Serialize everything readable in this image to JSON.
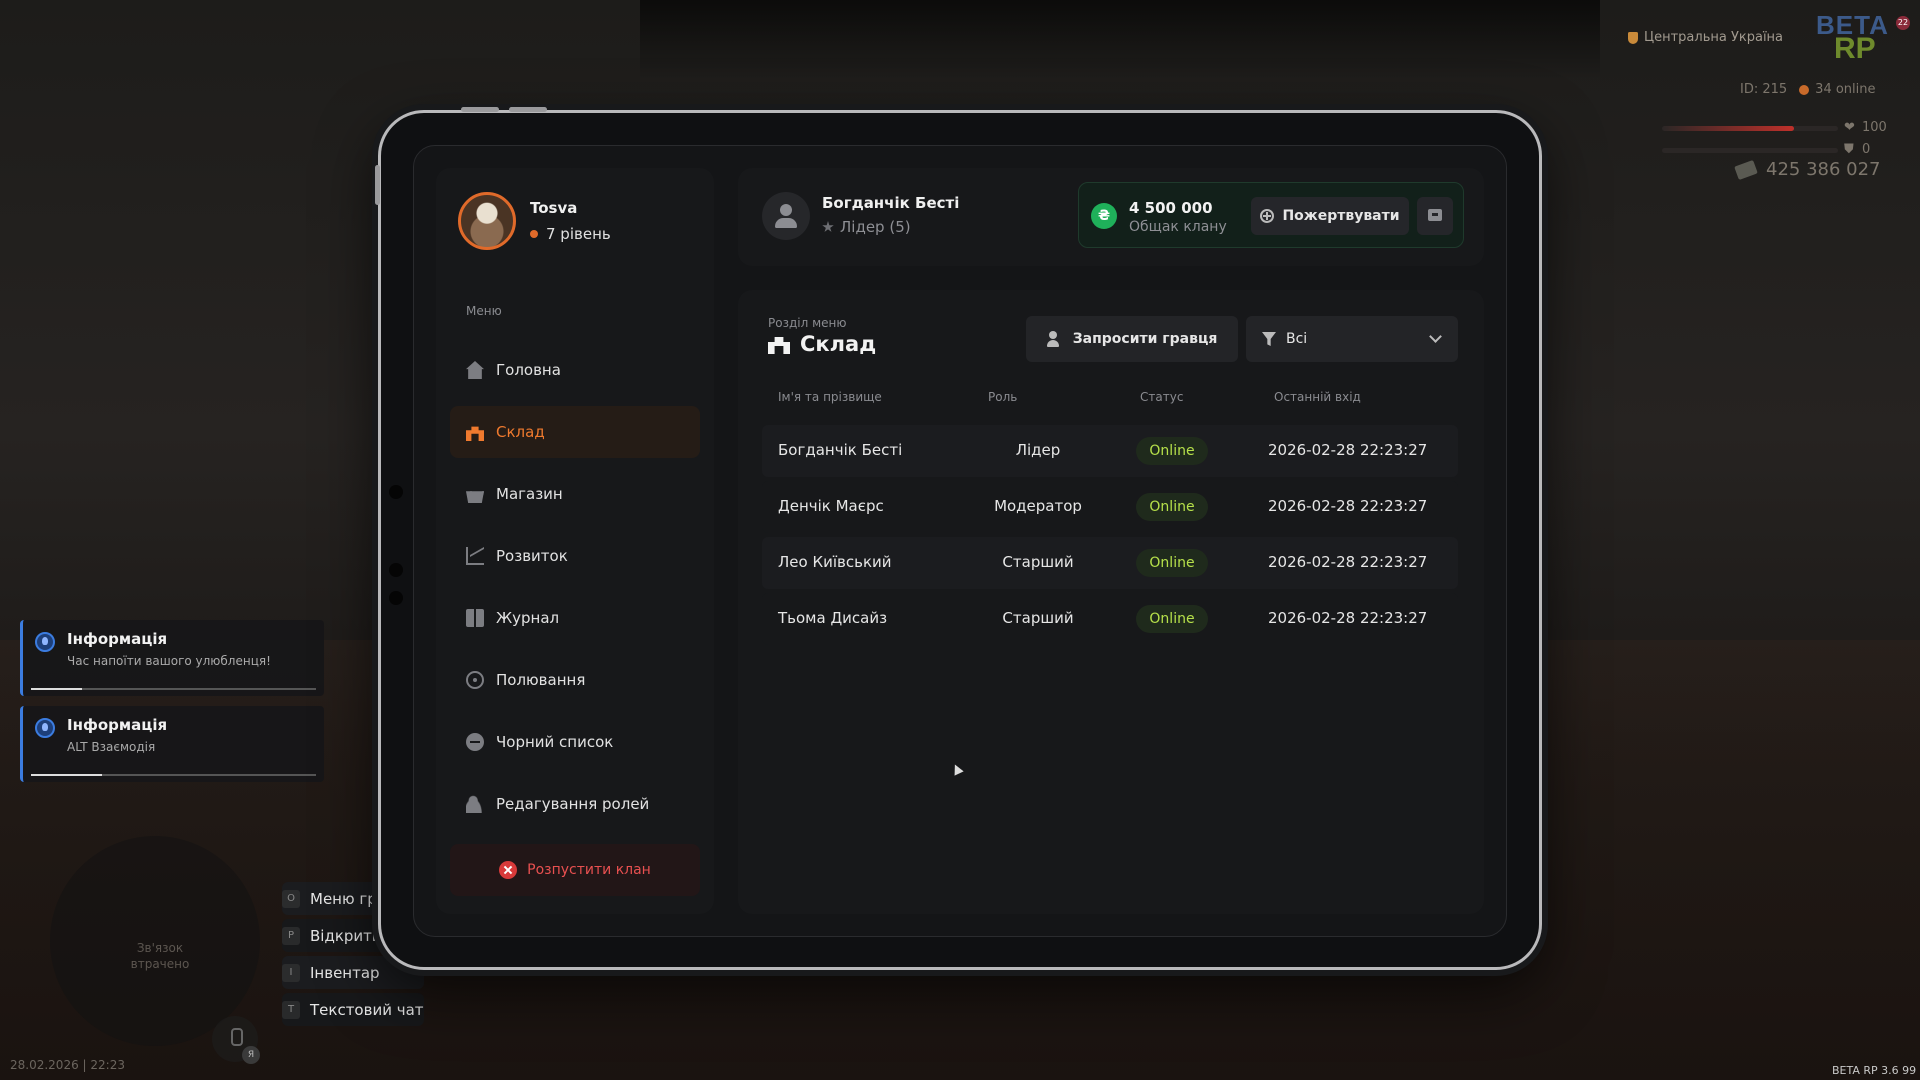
{
  "hud": {
    "region": "Центральна Україна",
    "logo_top": "BETA",
    "logo_bottom": "RP",
    "logo_badge": "22",
    "player_id": "ID: 215",
    "online": "34 online",
    "health_value": "100",
    "health_fraction": 0.75,
    "armor_value": "0",
    "armor_fraction": 0.0,
    "money": "425 386 027",
    "datetime": "28.02.2026 | 22:23",
    "version": "BETA RP 3.6",
    "version_suffix": "99",
    "radar_text": "Зв'язок втрачено",
    "mic_badge": "Я",
    "hotkeys": [
      {
        "key": "O",
        "label": "Меню гра"
      },
      {
        "key": "P",
        "label": "Відкрити"
      },
      {
        "key": "I",
        "label": "Інвентар"
      },
      {
        "key": "T",
        "label": "Текстовий чат"
      }
    ],
    "colors": {
      "health": "#c0302a",
      "accent": "#f07a2e",
      "online_status": "#b6e04a",
      "bank": "#1fb05a"
    }
  },
  "notifications": [
    {
      "title": "Інформація",
      "message": "Час напоїти вашого улюбленця!",
      "progress": 0.18
    },
    {
      "title": "Інформація",
      "message": "ALT Взаємодія",
      "progress": 0.25
    }
  ],
  "sidebar": {
    "player_name": "Tosva",
    "player_level": "7 рівень",
    "menu_caption": "Меню",
    "items": [
      {
        "label": "Головна",
        "icon": "home-icon",
        "active": false
      },
      {
        "label": "Склад",
        "icon": "warehouse-icon",
        "active": true
      },
      {
        "label": "Магазин",
        "icon": "shop-icon",
        "active": false
      },
      {
        "label": "Розвиток",
        "icon": "growth-chart-icon",
        "active": false
      },
      {
        "label": "Журнал",
        "icon": "journal-icon",
        "active": false
      },
      {
        "label": "Полювання",
        "icon": "crosshair-icon",
        "active": false
      },
      {
        "label": "Чорний список",
        "icon": "blacklist-icon",
        "active": false
      },
      {
        "label": "Редагування ролей",
        "icon": "user-edit-icon",
        "active": false
      }
    ],
    "dissolve_label": "Розпустити клан"
  },
  "header": {
    "leader_name": "Богданчік Бесті",
    "leader_role": "Лідер (5)",
    "bank_amount": "4 500 000",
    "bank_label": "Общак клану",
    "bank_currency_symbol": "₴",
    "donate_label": "Пожертвувати"
  },
  "main": {
    "section_caption": "Розділ меню",
    "section_title": "Склад",
    "invite_label": "Запросити гравця",
    "filter_value": "Всі",
    "columns": [
      "Ім'я та прізвище",
      "Роль",
      "Статус",
      "Останній вхід"
    ],
    "rows": [
      {
        "name": "Богданчік Бесті",
        "role": "Лідер",
        "status": "Online",
        "last_login": "2026-02-28 22:23:27"
      },
      {
        "name": "Денчік Маєрс",
        "role": "Модератор",
        "status": "Online",
        "last_login": "2026-02-28 22:23:27"
      },
      {
        "name": "Лео Київський",
        "role": "Старший",
        "status": "Online",
        "last_login": "2026-02-28 22:23:27"
      },
      {
        "name": "Тьома Дисайз",
        "role": "Старший",
        "status": "Online",
        "last_login": "2026-02-28 22:23:27"
      }
    ]
  }
}
